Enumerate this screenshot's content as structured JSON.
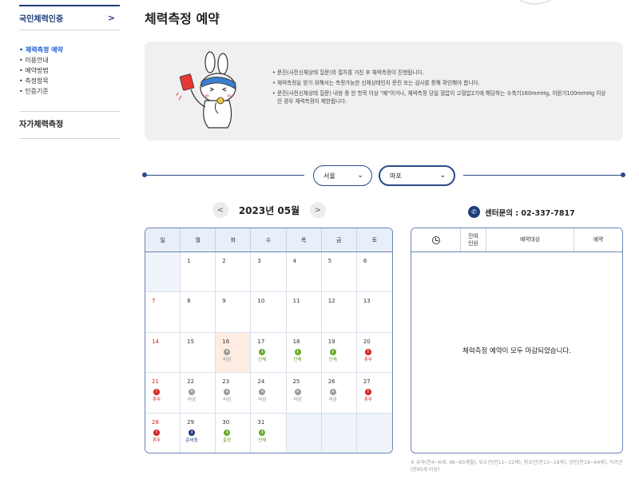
{
  "sidebar": {
    "main_label": "국민체력인증",
    "chevron": ">",
    "items": [
      {
        "label": "체력측정 예약"
      },
      {
        "label": "이용안내"
      },
      {
        "label": "예약방법"
      },
      {
        "label": "측정항목"
      },
      {
        "label": "인증기준"
      }
    ],
    "second_label": "자가체력측정"
  },
  "page": {
    "title": "체력측정 예약"
  },
  "notice": {
    "items": [
      "문진(사전신체상태 질문)의 절차를 거친 후 체력측정이 진행됩니다.",
      "체력측정을 받기 위해서는 측정가능한 신체상태인지 문진 또는 검사를 통해 확인해야 합니다.",
      "문진(사전신체상태 질문) 내용 중 한 항목 이상 \"예\"이거나, 체력측정 당일 혈압이 고혈압2기에 해당하는 수축기160mmHg, 이완기100mmHg 이상인 경우 체력측정이 제한됩니다."
    ]
  },
  "region": {
    "city": "서울",
    "district": "마포"
  },
  "calendar": {
    "month_label": "2023년 05월",
    "prev": "<",
    "next": ">",
    "weekdays": [
      "일",
      "월",
      "화",
      "수",
      "목",
      "금",
      "토"
    ],
    "status_labels": {
      "closed": "마감",
      "group": "단체",
      "holiday": "휴무",
      "preparing": "준비중",
      "dispatch": "출장"
    },
    "cells": [
      {
        "day": ""
      },
      {
        "day": "1"
      },
      {
        "day": "2"
      },
      {
        "day": "3"
      },
      {
        "day": "4"
      },
      {
        "day": "5"
      },
      {
        "day": "6"
      },
      {
        "day": "7"
      },
      {
        "day": "8"
      },
      {
        "day": "9"
      },
      {
        "day": "10"
      },
      {
        "day": "11"
      },
      {
        "day": "12"
      },
      {
        "day": "13"
      },
      {
        "day": "14"
      },
      {
        "day": "15"
      },
      {
        "day": "16",
        "status": "closed",
        "today": true
      },
      {
        "day": "17",
        "status": "group"
      },
      {
        "day": "18",
        "status": "group"
      },
      {
        "day": "19",
        "status": "group"
      },
      {
        "day": "20",
        "status": "holiday"
      },
      {
        "day": "21",
        "status": "holiday"
      },
      {
        "day": "22",
        "status": "closed"
      },
      {
        "day": "23",
        "status": "closed"
      },
      {
        "day": "24",
        "status": "closed"
      },
      {
        "day": "25",
        "status": "closed"
      },
      {
        "day": "26",
        "status": "closed"
      },
      {
        "day": "27",
        "status": "holiday"
      },
      {
        "day": "28",
        "status": "holiday"
      },
      {
        "day": "29",
        "status": "preparing"
      },
      {
        "day": "30",
        "status": "dispatch"
      },
      {
        "day": "31",
        "status": "group"
      },
      {
        "day": ""
      },
      {
        "day": ""
      },
      {
        "day": ""
      }
    ]
  },
  "contact": {
    "label": "센터문의 : 02-337-7817"
  },
  "reservation": {
    "columns": [
      "잔여\n인원",
      "예약대상",
      "예약"
    ],
    "empty_message": "체력측정 예약이 모두 마감되었습니다."
  },
  "footnote": "※ 유아(만4~6세, 48~83개월), 유소년(만11~12세), 청소년(만13~18세), 성인(만19~64세), 어르신(만65세 이상)",
  "colors": {
    "navy": "#1e3c7a",
    "holiday_red": "#d32222",
    "group_green": "#6aaa2a",
    "closed_gray": "#9a9a9a"
  }
}
